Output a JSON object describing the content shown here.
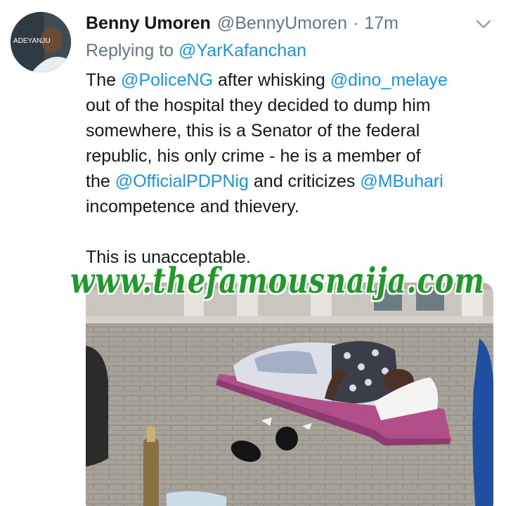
{
  "tweet": {
    "author_name": "Benny Umoren",
    "handle": "@BennyUmoren",
    "separator": "·",
    "time": "17m",
    "avatar_caption": "ADEYANJU",
    "replying_prefix": "Replying to",
    "replying_to": "@YarKafanchan",
    "body_lines": [
      {
        "before": "The ",
        "mention1": "@PoliceNG",
        "middle": " after whisking ",
        "mention2": "@dino_melaye",
        "after": ""
      },
      {
        "text": "out of the hospital they decided to dump him"
      },
      {
        "text": "somewhere, this is a Senator of the federal"
      },
      {
        "text": "republic, his only  crime - he is a member of"
      },
      {
        "before": "the ",
        "mention1": "@OfficialPDPNig",
        "middle": " and criticizes ",
        "mention2": "@MBuhari",
        "after": ""
      },
      {
        "text": "incompetence and thievery."
      }
    ],
    "closing_line": "This is unacceptable.",
    "watermark": "www.thefamousnaija.com"
  },
  "colors": {
    "link": "#1b95e0",
    "text": "#14171a",
    "muted": "#657786",
    "watermark": "#1f9a2a"
  },
  "icons": {
    "menu": "chevron-down-icon"
  }
}
